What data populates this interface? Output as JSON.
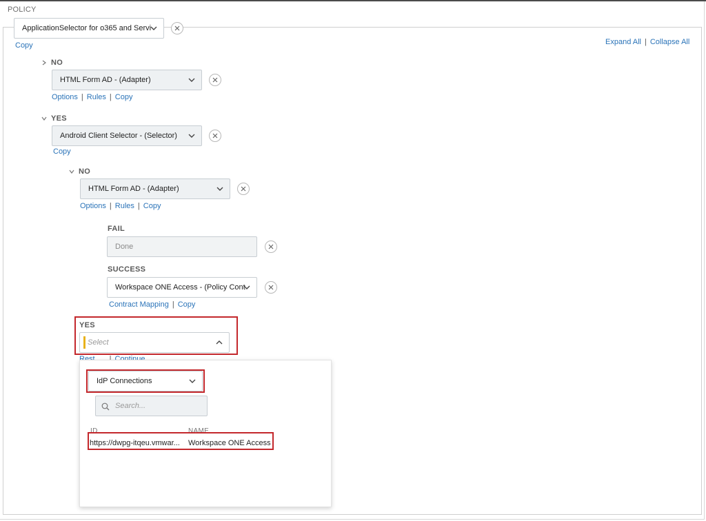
{
  "policy_label": "POLICY",
  "root": {
    "selector_value": "ApplicationSelector for o365 and Servi",
    "copy_label": "Copy"
  },
  "header_links": {
    "expand_all": "Expand All",
    "separator": "|",
    "collapse_all": "Collapse All"
  },
  "branch_no_1": {
    "label": "NO",
    "selector_value": "HTML Form AD - (Adapter)",
    "links": [
      "Options",
      "Rules",
      "Copy"
    ]
  },
  "branch_yes_1": {
    "label": "YES",
    "selector_value": "Android Client Selector - (Selector)",
    "copy_label": "Copy"
  },
  "branch_no_2": {
    "label": "NO",
    "selector_value": "HTML Form AD - (Adapter)",
    "links": [
      "Options",
      "Rules",
      "Copy"
    ]
  },
  "fail": {
    "label": "FAIL",
    "value": "Done"
  },
  "success": {
    "label": "SUCCESS",
    "selector_value": "Workspace ONE Access - (Policy Cont",
    "links": [
      "Contract Mapping",
      "Copy"
    ]
  },
  "branch_yes_2": {
    "label": "YES",
    "placeholder": "Select",
    "partial_links": [
      "Rest",
      "Continue"
    ]
  },
  "popup": {
    "type_value": "IdP Connections",
    "search_placeholder": "Search...",
    "columns": [
      "ID",
      "NAME"
    ],
    "rows": [
      {
        "id": "https://dwpg-itqeu.vmwar...",
        "name": "Workspace ONE Access"
      }
    ]
  },
  "colors": {
    "link": "#2a73b8",
    "highlight": "#c3272b",
    "required_marker": "#e8b21b"
  }
}
